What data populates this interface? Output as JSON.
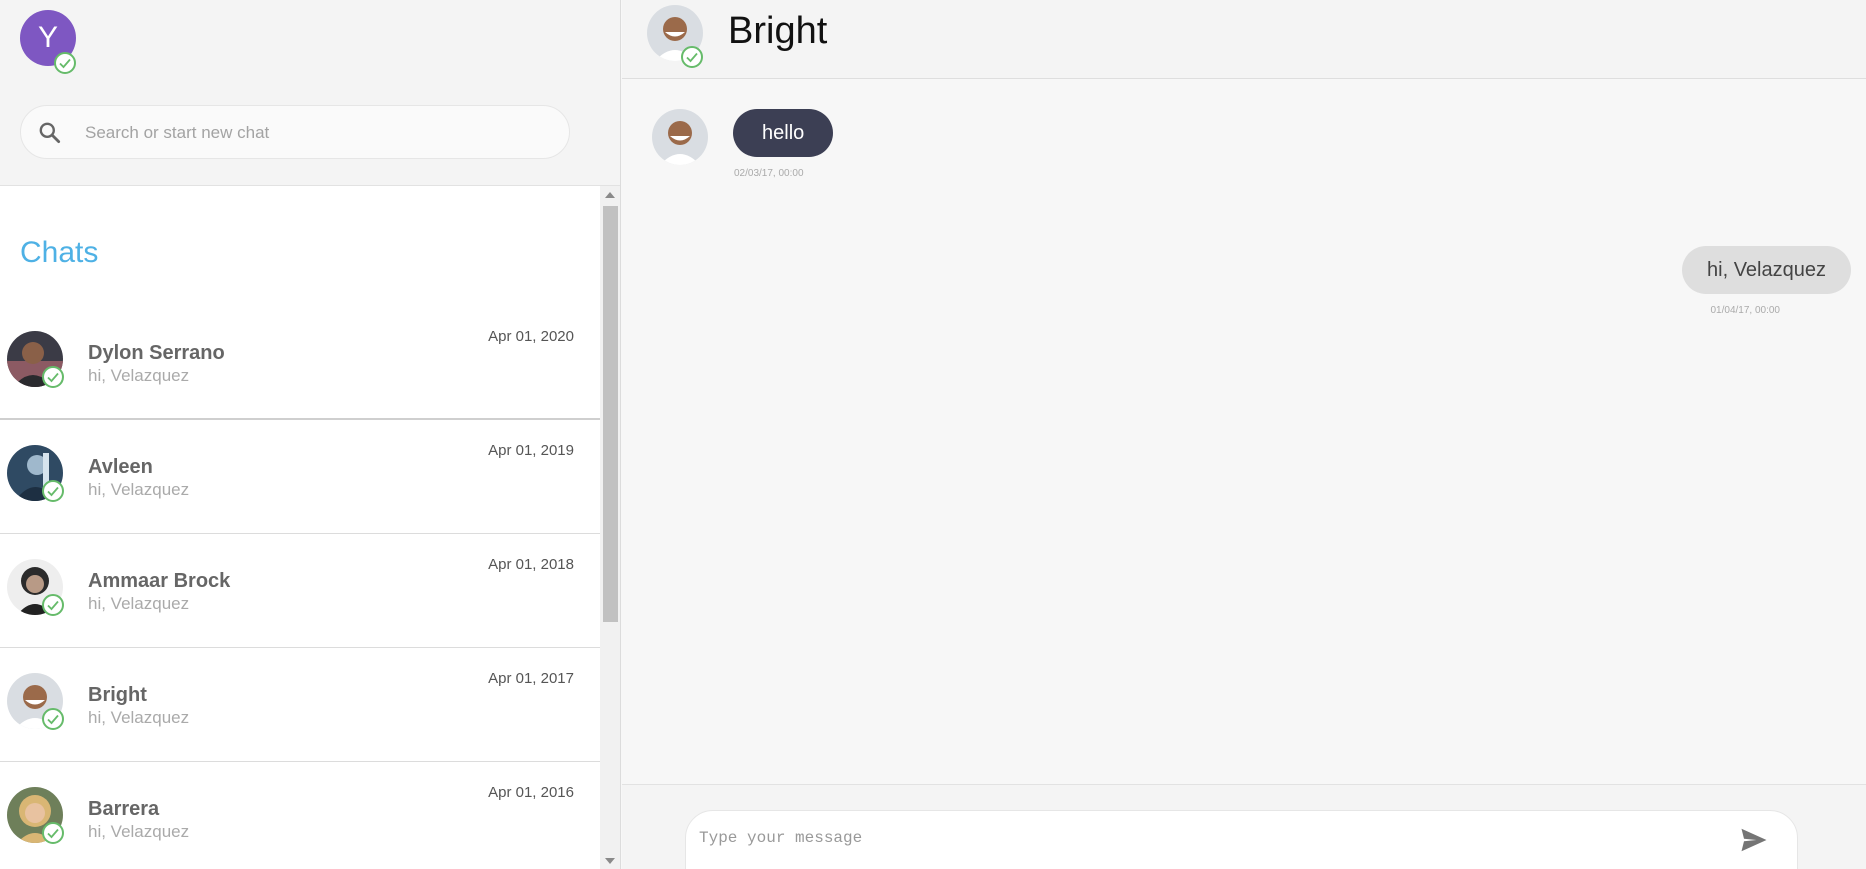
{
  "me": {
    "initial": "Y",
    "avatar_color": "#7e57c2",
    "status": "online"
  },
  "search": {
    "placeholder": "Search or start new chat",
    "value": ""
  },
  "chats_title": "Chats",
  "chats": [
    {
      "name": "Dylon Serrano",
      "preview": "hi, Velazquez",
      "date": "Apr 01, 2020",
      "avatar_color": "#3b3b46"
    },
    {
      "name": "Avleen",
      "preview": "hi, Velazquez",
      "date": "Apr 01, 2019",
      "avatar_color": "#2f4a63"
    },
    {
      "name": "Ammaar Brock",
      "preview": "hi, Velazquez",
      "date": "Apr 01, 2018",
      "avatar_color": "#e6e6e6"
    },
    {
      "name": "Bright",
      "preview": "hi, Velazquez",
      "date": "Apr 01, 2017",
      "avatar_color": "#b07a54"
    },
    {
      "name": "Barrera",
      "preview": "hi, Velazquez",
      "date": "Apr 01, 2016",
      "avatar_color": "#c8a06a"
    }
  ],
  "conversation": {
    "contact_name": "Bright",
    "messages": [
      {
        "direction": "in",
        "text": "hello",
        "time": "02/03/17, 00:00"
      },
      {
        "direction": "out",
        "text": "hi, Velazquez",
        "time": "01/04/17, 00:00"
      }
    ],
    "composer_placeholder": "Type your message",
    "composer_value": ""
  },
  "colors": {
    "accent": "#4eb1e5",
    "online": "#66bb6a",
    "incoming_bubble": "#3c3f54",
    "outgoing_bubble": "#dedede"
  }
}
